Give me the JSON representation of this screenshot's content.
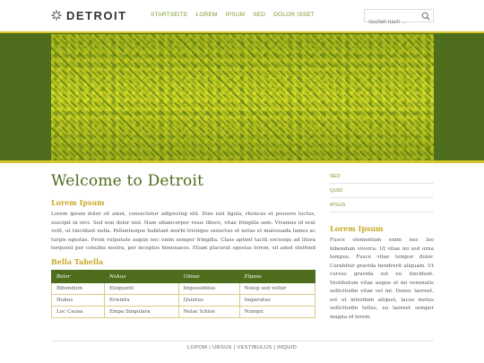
{
  "header": {
    "logo_text": "DETROIT",
    "logo_icon": "sunburst-icon",
    "nav": [
      "STARTSEITE",
      "LOREM",
      "IPSUM",
      "SED",
      "DOLOR ISSET"
    ],
    "search_placeholder": "Suchen nach ...",
    "search_icon": "search-icon"
  },
  "colors": {
    "brand_green": "#4e6d1d",
    "accent_gold": "#c9a82e",
    "link_green": "#7a9a2c",
    "band_yellow": "#d6c62e"
  },
  "main": {
    "title": "Welcome to Detroit",
    "subtitle": "Lorem Ipsum",
    "paragraph": "Lorem ipsum dolor sit amet, consectetur adipiscing elit. Duis nisl ligula, rhoncus et posuere luctus, suscipit in orci. Sed non dolor nisl. Nam ullamcorper risus libero, vitae fringilla sem. Vivamus id erat velit, ut tincidunt nulla. Pellentesque habitant morbi tristique senectus et netus et malesuada fames ac turpis egestas. Proin vulputate augue nec enim semper fringilla. Class aptent taciti sociosqu ad litora torquent per conubia nostra, per inceptos himenaeos. Etiam placerat egestas lorem, sit amet eleifend felis blandit vitae.",
    "table_title": "Bella Tabella",
    "table": {
      "headers": [
        "Bolor",
        "Nukus",
        "Udoso",
        "Elpaso"
      ],
      "rows": [
        [
          "Bibendum",
          "Eloquenti",
          "Impossibilus",
          "Nolep sed volter"
        ],
        [
          "Nukus",
          "Erwintu",
          "Quintus",
          "Imperatus"
        ],
        [
          "Loc Causa",
          "Empa Singulara",
          "Nelac Ichios",
          "Nunqui"
        ]
      ]
    }
  },
  "sidebar": {
    "links": [
      "SED",
      "QUID",
      "IPSUS"
    ],
    "title": "Lorem Ipsum",
    "paragraph": "Fusce elementum enim nec leo bibendum viverra. Ut vitae mi sed urna tempus. Fusce vitae tempor dolor. Curabitur gravida hendrerit aliquam. Ut cursus gravida est eu tincidunt. Vestibulum vitae augue et mi venenatis sollicitudin vitae vel mi. Donec laoreet, est ut interdum aliquet, lacus metus sollicitudin tellus, eu laoreet semper magna id lorem."
  },
  "footer": {
    "text": "LOPOM | URSUS | VESTIBULUS | INQUID"
  }
}
